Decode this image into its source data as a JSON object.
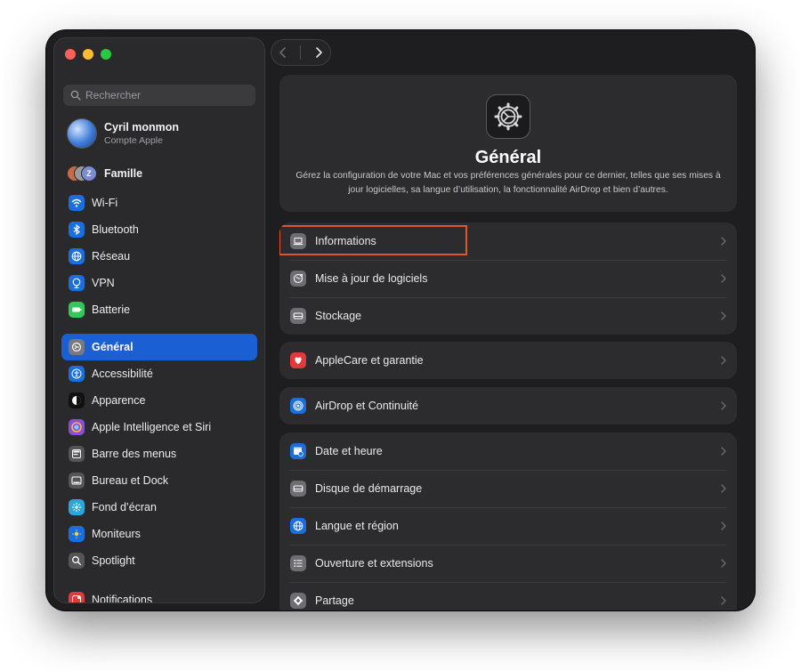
{
  "window": {
    "traffic_lights": [
      "close",
      "minimize",
      "zoom"
    ]
  },
  "sidebar": {
    "search_placeholder": "Rechercher",
    "account": {
      "name": "Cyril monmon",
      "subtitle": "Compte Apple"
    },
    "family": {
      "label": "Famille",
      "badge": "Z"
    },
    "groups": [
      [
        {
          "label": "Wi-Fi",
          "icon": "wifi-icon",
          "color": "#1a6fe0"
        },
        {
          "label": "Bluetooth",
          "icon": "bluetooth-icon",
          "color": "#1a6fe0"
        },
        {
          "label": "Réseau",
          "icon": "globe-icon",
          "color": "#1a6fe0"
        },
        {
          "label": "VPN",
          "icon": "vpn-icon",
          "color": "#1a6fe0"
        },
        {
          "label": "Batterie",
          "icon": "battery-icon",
          "color": "#34c759"
        }
      ],
      [
        {
          "label": "Général",
          "icon": "gear-icon",
          "color": "#7a7a7e",
          "active": true
        },
        {
          "label": "Accessibilité",
          "icon": "accessibility-icon",
          "color": "#1a6fe0"
        },
        {
          "label": "Apparence",
          "icon": "appearance-icon",
          "color": "#111111"
        },
        {
          "label": "Apple Intelligence et Siri",
          "icon": "siri-icon",
          "color": "#8a4fd8"
        },
        {
          "label": "Barre des menus",
          "icon": "menubar-icon",
          "color": "#555558"
        },
        {
          "label": "Bureau et Dock",
          "icon": "dock-icon",
          "color": "#555558"
        },
        {
          "label": "Fond d’écran",
          "icon": "wallpaper-icon",
          "color": "#2aa6d8"
        },
        {
          "label": "Moniteurs",
          "icon": "display-icon",
          "color": "#1a6fe0"
        },
        {
          "label": "Spotlight",
          "icon": "spotlight-icon",
          "color": "#555558"
        }
      ],
      [
        {
          "label": "Notifications",
          "icon": "notifications-icon",
          "color": "#e23a3a"
        }
      ]
    ]
  },
  "content": {
    "title": "Général",
    "description": "Gérez la configuration de votre Mac et vos préférences générales pour ce dernier, telles que ses mises à jour logicielles, sa langue d’utilisation, la fonctionnalité AirDrop et bien d’autres.",
    "cards": [
      [
        {
          "label": "Informations",
          "icon": "laptop-icon",
          "color": "#6e6e72",
          "highlighted": true
        },
        {
          "label": "Mise à jour de logiciels",
          "icon": "software-update-icon",
          "color": "#6e6e72"
        },
        {
          "label": "Stockage",
          "icon": "storage-icon",
          "color": "#6e6e72"
        }
      ],
      [
        {
          "label": "AppleCare et garantie",
          "icon": "applecare-icon",
          "color": "#e23a3a"
        }
      ],
      [
        {
          "label": "AirDrop et Continuité",
          "icon": "airdrop-icon",
          "color": "#1a6fe0"
        }
      ],
      [
        {
          "label": "Date et heure",
          "icon": "calendar-clock-icon",
          "color": "#1a6fe0"
        },
        {
          "label": "Disque de démarrage",
          "icon": "disk-icon",
          "color": "#6e6e72"
        },
        {
          "label": "Langue et région",
          "icon": "globe-icon",
          "color": "#1a6fe0"
        },
        {
          "label": "Ouverture et extensions",
          "icon": "list-icon",
          "color": "#6e6e72"
        },
        {
          "label": "Partage",
          "icon": "sharing-icon",
          "color": "#6e6e72"
        }
      ]
    ]
  }
}
